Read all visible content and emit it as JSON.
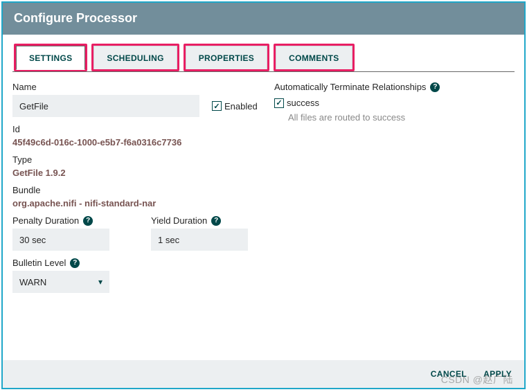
{
  "header": {
    "title": "Configure Processor"
  },
  "tabs": {
    "settings": "SETTINGS",
    "scheduling": "SCHEDULING",
    "properties": "PROPERTIES",
    "comments": "COMMENTS"
  },
  "fields": {
    "name_label": "Name",
    "name_value": "GetFile",
    "enabled_label": "Enabled",
    "id_label": "Id",
    "id_value": "45f49c6d-016c-1000-e5b7-f6a0316c7736",
    "type_label": "Type",
    "type_value": "GetFile 1.9.2",
    "bundle_label": "Bundle",
    "bundle_value": "org.apache.nifi - nifi-standard-nar",
    "penalty_label": "Penalty Duration",
    "penalty_value": "30 sec",
    "yield_label": "Yield Duration",
    "yield_value": "1 sec",
    "bulletin_label": "Bulletin Level",
    "bulletin_value": "WARN"
  },
  "right": {
    "auto_terminate_label": "Automatically Terminate Relationships",
    "rel_success": "success",
    "rel_success_desc": "All files are routed to success"
  },
  "footer": {
    "cancel": "CANCEL",
    "apply": "APPLY"
  },
  "watermark": "CSDN @赵广陆"
}
